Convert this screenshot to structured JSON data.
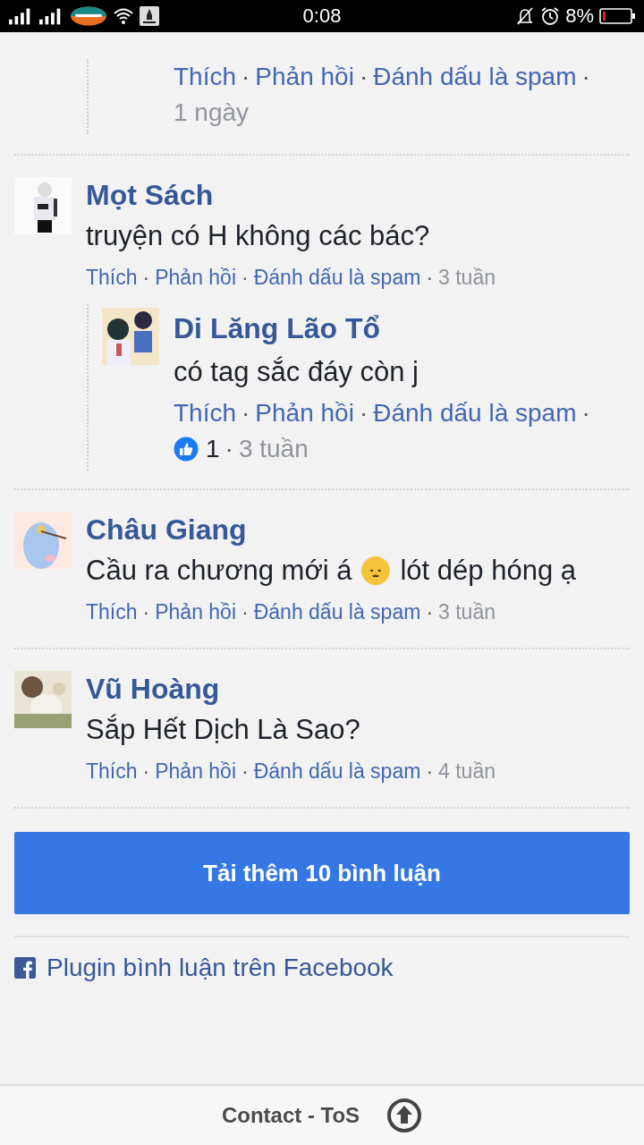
{
  "status_bar": {
    "time": "0:08",
    "battery": "8%"
  },
  "comments": [
    {
      "replies": [
        {
          "actions": [
            {
              "kind": "like",
              "text": "Thích"
            },
            {
              "kind": "dot",
              "text": "·"
            },
            {
              "kind": "reply",
              "text": "Phản hồi"
            },
            {
              "kind": "dot",
              "text": "·"
            },
            {
              "kind": "spam",
              "text": "Đánh dấu là spam"
            },
            {
              "kind": "dot",
              "text": "·"
            },
            {
              "kind": "time",
              "text": "1 ngày"
            }
          ]
        }
      ]
    },
    {
      "name": "Mọt Sách",
      "text": [
        "truyện có H không các bác?"
      ],
      "actions": [
        {
          "kind": "like",
          "text": "Thích"
        },
        {
          "kind": "dot",
          "text": "·"
        },
        {
          "kind": "reply",
          "text": "Phản hồi"
        },
        {
          "kind": "dot",
          "text": "·"
        },
        {
          "kind": "spam",
          "text": "Đánh dấu là spam"
        },
        {
          "kind": "dot",
          "text": "·"
        },
        {
          "kind": "time",
          "text": "3 tuần"
        }
      ],
      "replies": [
        {
          "name": "Di Lăng Lão Tổ",
          "text": [
            "có tag sắc đáy còn j"
          ],
          "actions": [
            {
              "kind": "like",
              "text": "Thích"
            },
            {
              "kind": "dot",
              "text": "·"
            },
            {
              "kind": "reply",
              "text": "Phản hồi"
            },
            {
              "kind": "dot",
              "text": "·"
            },
            {
              "kind": "spam",
              "text": "Đánh dấu là spam"
            },
            {
              "kind": "dot",
              "text": "·"
            },
            {
              "kind": "likes",
              "text": "1"
            },
            {
              "kind": "dot",
              "text": "·"
            },
            {
              "kind": "time",
              "text": "3 tuần"
            }
          ]
        }
      ]
    },
    {
      "name": "Châu Giang",
      "text": [
        "Cầu ra chương mới á",
        "lót dép hóng ạ"
      ],
      "actions": [
        {
          "kind": "like",
          "text": "Thích"
        },
        {
          "kind": "dot",
          "text": "·"
        },
        {
          "kind": "reply",
          "text": "Phản hồi"
        },
        {
          "kind": "dot",
          "text": "·"
        },
        {
          "kind": "spam",
          "text": "Đánh dấu là spam"
        },
        {
          "kind": "dot",
          "text": "·"
        },
        {
          "kind": "time",
          "text": "3 tuần"
        }
      ]
    },
    {
      "name": "Vũ Hoàng",
      "text": [
        "Sắp Hết Dịch Là Sao?"
      ],
      "actions": [
        {
          "kind": "like",
          "text": "Thích"
        },
        {
          "kind": "dot",
          "text": "·"
        },
        {
          "kind": "reply",
          "text": "Phản hồi"
        },
        {
          "kind": "dot",
          "text": "·"
        },
        {
          "kind": "spam",
          "text": "Đánh dấu là spam"
        },
        {
          "kind": "dot",
          "text": "·"
        },
        {
          "kind": "time",
          "text": "4 tuần"
        }
      ]
    }
  ],
  "load_more": "Tải thêm 10 bình luận",
  "plugin_link": "Plugin bình luận trên Facebook",
  "footer": {
    "links": "Contact - ToS"
  }
}
